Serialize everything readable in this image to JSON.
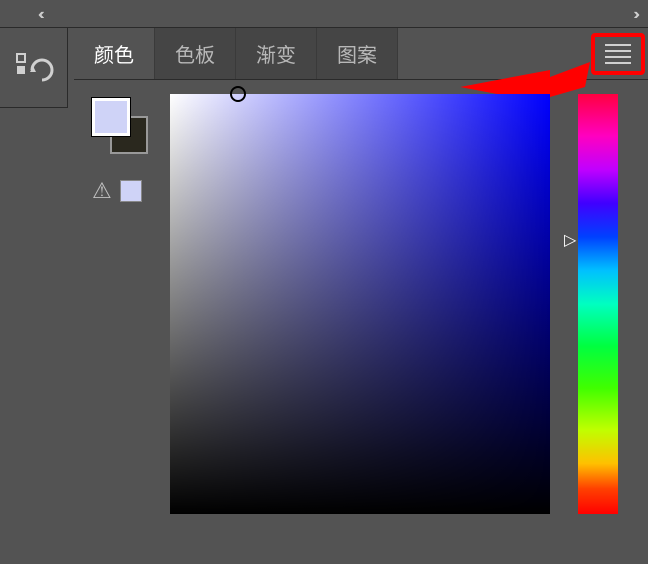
{
  "tabs": {
    "color": "颜色",
    "swatches": "色板",
    "gradient": "渐变",
    "pattern": "图案"
  },
  "activeTab": "color",
  "colors": {
    "foreground": "#cfd3f7",
    "background": "#2a281e",
    "hue_deg": 240
  },
  "icons": {
    "collapse": "‹‹",
    "expand": "››",
    "warning": "⚠"
  }
}
